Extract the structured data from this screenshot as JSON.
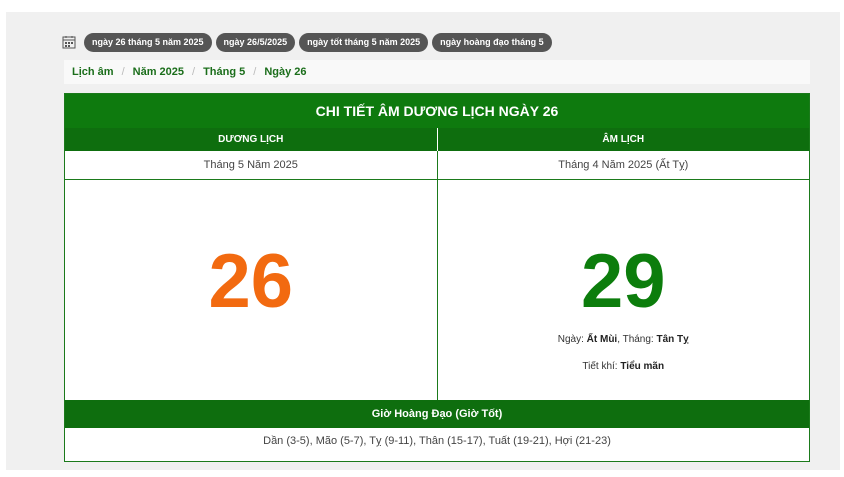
{
  "tags": [
    "ngày 26 tháng 5 năm 2025",
    "ngày 26/5/2025",
    "ngày tốt tháng 5 năm 2025",
    "ngày hoàng đạo tháng 5"
  ],
  "breadcrumb": [
    "Lịch âm",
    "Năm 2025",
    "Tháng 5",
    "Ngày 26"
  ],
  "card": {
    "title": "CHI TIẾT ÂM DƯƠNG LỊCH NGÀY 26",
    "solar": {
      "header": "DƯƠNG LỊCH",
      "month_year": "Tháng 5 Năm 2025",
      "day": "26"
    },
    "lunar": {
      "header": "ÂM LỊCH",
      "month_year": "Tháng 4 Năm 2025 (Ất Tỵ)",
      "day": "29",
      "day_label": "Ngày: ",
      "day_can_chi": "Ất Mùi",
      "month_label": ", Tháng: ",
      "month_can_chi": "Tân Tỵ",
      "tiet_khi_label": "Tiết khí: ",
      "tiet_khi": "Tiểu mãn"
    },
    "gio_hoang_dao_title": "Giờ Hoàng Đạo (Giờ Tốt)",
    "gio_hoang_dao_list": "Dần (3-5), Mão (5-7), Tỵ (9-11), Thân (15-17), Tuất (19-21), Hợi (21-23)"
  },
  "colors": {
    "primary_green": "#0e7a0e",
    "solar_day": "#f26a10",
    "lunar_day": "#0c7d0c",
    "tag_bg": "#555555"
  },
  "icons": [
    "calendar-icon"
  ]
}
